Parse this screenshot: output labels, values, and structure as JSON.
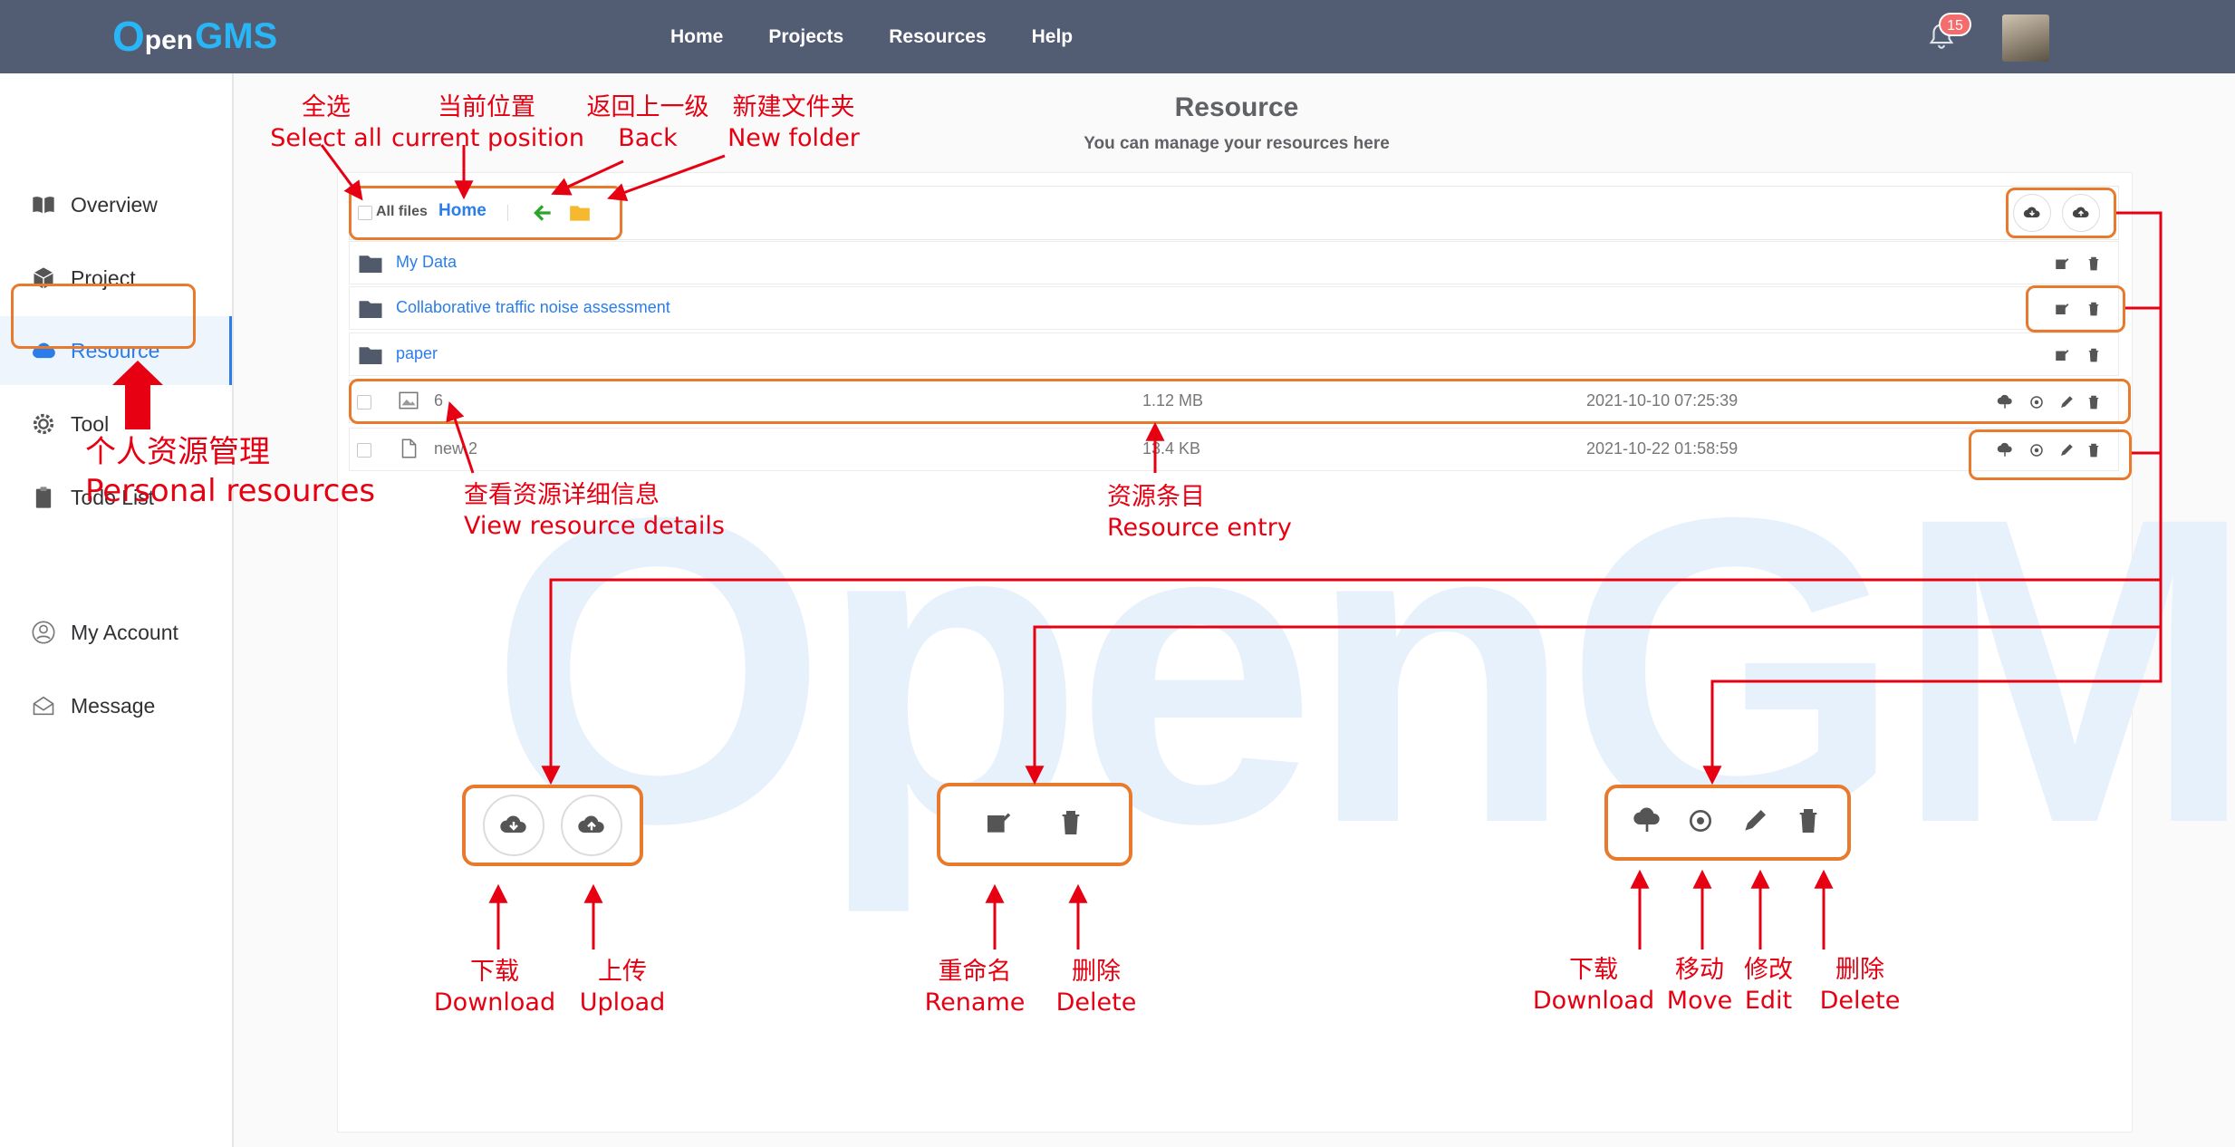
{
  "brand": {
    "logo_o": "O",
    "logo_pen": "pen",
    "logo_gms": "GMS"
  },
  "nav": {
    "links": [
      "Home",
      "Projects",
      "Resources",
      "Help"
    ],
    "notification_count": "15"
  },
  "sidebar": {
    "items": [
      {
        "label": "Overview",
        "icon": "book-icon"
      },
      {
        "label": "Project",
        "icon": "cube-icon"
      },
      {
        "label": "Resource",
        "icon": "cloud-icon",
        "active": true
      },
      {
        "label": "Tool",
        "icon": "gear-icon"
      },
      {
        "label": "Todo List",
        "icon": "clipboard-icon"
      },
      {
        "label": "My Account",
        "icon": "user-icon"
      },
      {
        "label": "Message",
        "icon": "envelope-icon"
      }
    ]
  },
  "main": {
    "title": "Resource",
    "subtitle": "You can manage your resources here",
    "toolbar": {
      "all_files": "All files",
      "current": "Home"
    },
    "folders": [
      {
        "name": "My Data"
      },
      {
        "name": "Collaborative traffic noise assessment"
      },
      {
        "name": "paper"
      }
    ],
    "files": [
      {
        "name": "6",
        "size": "1.12 MB",
        "date": "2021-10-10 07:25:39",
        "type": "image"
      },
      {
        "name": "new 2",
        "size": "13.4 KB",
        "date": "2021-10-22 01:58:59",
        "type": "document"
      }
    ],
    "watermark": "OpenGMS"
  },
  "annotations": {
    "select_all": {
      "zh": "全选",
      "en": "Select all"
    },
    "current_position": {
      "zh": "当前位置",
      "en": "current position"
    },
    "back": {
      "zh": "返回上一级",
      "en": "Back"
    },
    "new_folder": {
      "zh": "新建文件夹",
      "en": "New folder"
    },
    "personal_resources": {
      "zh": "个人资源管理",
      "en": "Personal resources"
    },
    "view_details": {
      "zh": "查看资源详细信息",
      "en": "View resource details"
    },
    "resource_entry": {
      "zh": "资源条目",
      "en": "Resource entry"
    },
    "download1": {
      "zh": "下载",
      "en": "Download"
    },
    "upload": {
      "zh": "上传",
      "en": "Upload"
    },
    "rename": {
      "zh": "重命名",
      "en": "Rename"
    },
    "delete1": {
      "zh": "删除",
      "en": "Delete"
    },
    "download2": {
      "zh": "下载",
      "en": "Download"
    },
    "move": {
      "zh": "移动",
      "en": "Move"
    },
    "edit": {
      "zh": "修改",
      "en": "Edit"
    },
    "delete2": {
      "zh": "删除",
      "en": "Delete"
    }
  },
  "colors": {
    "nav_bg": "#525c73",
    "accent": "#2b7de9",
    "annotation_red": "#e60012",
    "callout_orange": "#e87a2d",
    "badge": "#f56c6c"
  }
}
